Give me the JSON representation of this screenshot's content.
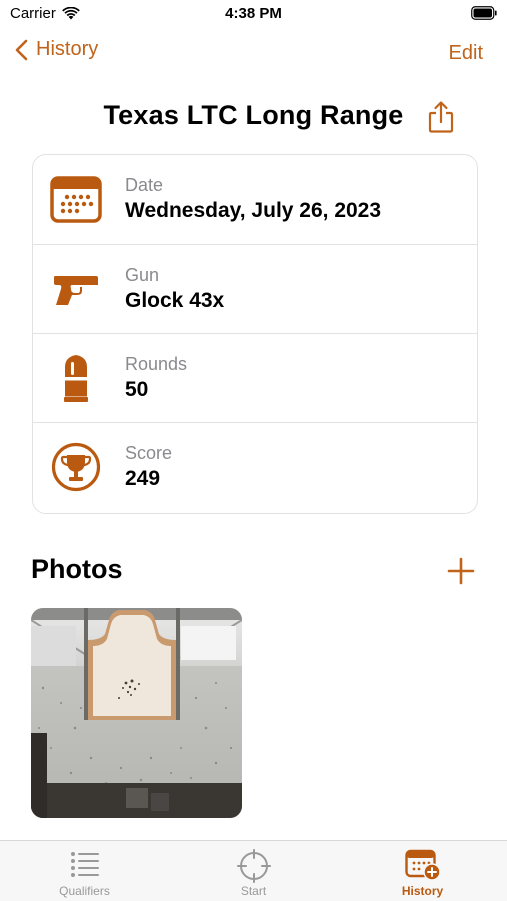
{
  "status_bar": {
    "carrier": "Carrier",
    "time": "4:38 PM"
  },
  "nav": {
    "back_label": "History",
    "edit_label": "Edit"
  },
  "title": "Texas LTC Long Range",
  "details": [
    {
      "label": "Date",
      "value": "Wednesday, July 26, 2023",
      "icon": "calendar-icon"
    },
    {
      "label": "Gun",
      "value": "Glock 43x",
      "icon": "pistol-icon"
    },
    {
      "label": "Rounds",
      "value": "50",
      "icon": "bullet-icon"
    },
    {
      "label": "Score",
      "value": "249",
      "icon": "trophy-icon"
    }
  ],
  "photos": {
    "heading": "Photos",
    "items": [
      {
        "description": "paper-target-photo"
      }
    ]
  },
  "tab_bar": {
    "tabs": [
      {
        "label": "Qualifiers",
        "icon": "list-icon",
        "active": false
      },
      {
        "label": "Start",
        "icon": "crosshair-icon",
        "active": false
      },
      {
        "label": "History",
        "icon": "calendar-add-icon",
        "active": true
      }
    ]
  },
  "colors": {
    "accent": "#c0631b",
    "icon_orange": "#b95a10",
    "secondary_text": "#8a8a8e",
    "inactive_tab": "#999999"
  }
}
